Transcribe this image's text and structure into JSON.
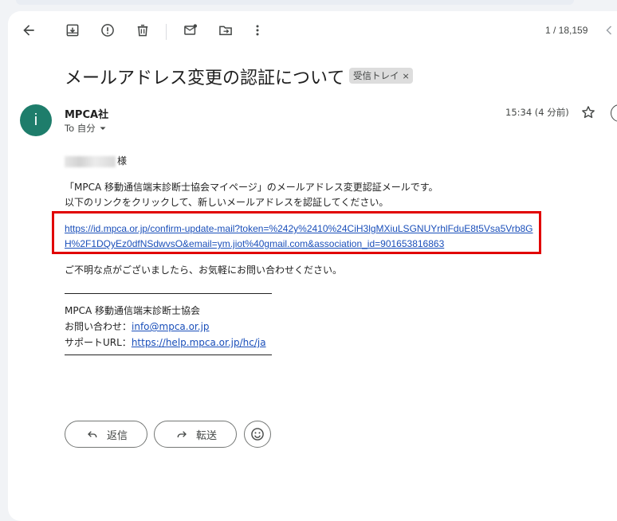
{
  "toolbar": {
    "back_icon": "arrow-left-icon",
    "archive_icon": "archive-icon",
    "report_icon": "report-spam-icon",
    "delete_icon": "trash-icon",
    "mark_unread_icon": "mark-unread-icon",
    "move_icon": "move-to-folder-icon",
    "more_icon": "more-vertical-icon",
    "counter": "1 / 18,159"
  },
  "email": {
    "subject": "メールアドレス変更の認証について",
    "label": "受信トレイ",
    "label_close": "×",
    "sender": {
      "initial": "i",
      "name": "MPCA社",
      "to": "To 自分",
      "avatar_color": "#1e7d6b"
    },
    "time": "15:34 (4 分前)",
    "body": {
      "greeting_suffix": "様",
      "line1": "「MPCA 移動通信端末診断士協会マイページ」のメールアドレス変更認証メールです。",
      "line2": "以下のリンクをクリックして、新しいメールアドレスを認証してください。",
      "link": "https://id.mpca.or.jp/confirm-update-mail?token=%242y%2410%24CiH3lgMXiuLSGNUYrhlFduE8t5Vsa5Vrb8GH%2F1DQyEz0dfNSdwvsO&email=ym.jiot%40gmail.com&association_id=901653816863",
      "closing": "ご不明な点がございましたら、お気軽にお問い合わせください。",
      "sig_org": "MPCA 移動通信端末診断士協会",
      "sig_contact_label": "お問い合わせ：",
      "sig_contact_email": "info@mpca.or.jp",
      "sig_support_label": "サポートURL：",
      "sig_support_url": "https://help.mpca.or.jp/hc/ja"
    }
  },
  "actions": {
    "reply": "返信",
    "forward": "転送",
    "emoji_icon": "emoji-icon"
  },
  "colors": {
    "link": "#1a4fba",
    "highlight_box": "#e10000"
  }
}
